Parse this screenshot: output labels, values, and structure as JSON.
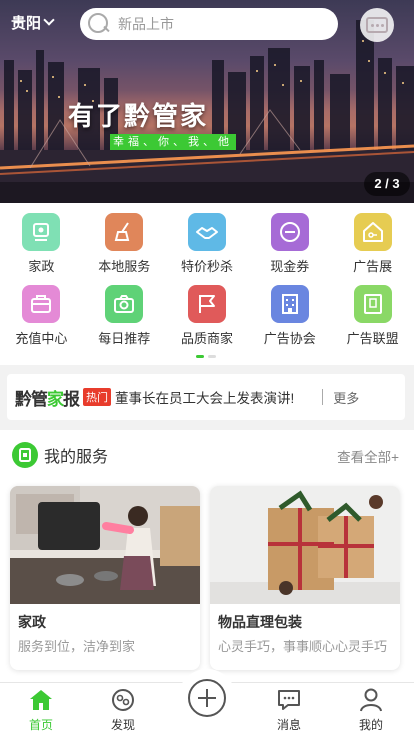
{
  "header": {
    "city": "贵阳",
    "search_placeholder": "新品上市"
  },
  "banner": {
    "title": "有了黔管家",
    "slogan": "幸福、你、我、他",
    "counter": "2 / 3"
  },
  "categories": [
    {
      "label": "家政",
      "color": "#7fe0b4",
      "icon": "home-service-icon"
    },
    {
      "label": "本地服务",
      "color": "#e0865a",
      "icon": "broom-icon"
    },
    {
      "label": "特价秒杀",
      "color": "#5fb9e6",
      "icon": "handshake-icon"
    },
    {
      "label": "现金券",
      "color": "#a66bd6",
      "icon": "coupon-icon"
    },
    {
      "label": "广告展",
      "color": "#e6cc52",
      "icon": "house-key-icon"
    },
    {
      "label": "充值中心",
      "color": "#e48ad6",
      "icon": "bag-icon"
    },
    {
      "label": "每日推荐",
      "color": "#5fd277",
      "icon": "camera-icon"
    },
    {
      "label": "品质商家",
      "color": "#e05a5a",
      "icon": "flag-icon"
    },
    {
      "label": "广告协会",
      "color": "#6a86e0",
      "icon": "building-icon"
    },
    {
      "label": "广告联盟",
      "color": "#8ad866",
      "icon": "document-icon"
    }
  ],
  "news": {
    "logo_a": "黔管",
    "logo_b": "家",
    "logo_c": "报",
    "badge": "热门",
    "headline": "董事长在员工大会上发表演讲!",
    "more": "更多"
  },
  "services": {
    "title": "我的服务",
    "view_all": "查看全部+",
    "cards": [
      {
        "name": "家政",
        "desc": "服务到位，洁净到家"
      },
      {
        "name": "物品直理包装",
        "desc": "心灵手巧，事事顺心心灵手巧"
      }
    ]
  },
  "tabbar": {
    "items": [
      {
        "label": "首页",
        "icon": "home-icon",
        "active": true
      },
      {
        "label": "发现",
        "icon": "discover-icon",
        "active": false
      },
      {
        "label": "",
        "icon": "plus-icon",
        "active": false
      },
      {
        "label": "消息",
        "icon": "message-icon",
        "active": false
      },
      {
        "label": "我的",
        "icon": "profile-icon",
        "active": false
      }
    ]
  },
  "colors": {
    "accent": "#3cc934",
    "hot": "#e83c2c"
  }
}
